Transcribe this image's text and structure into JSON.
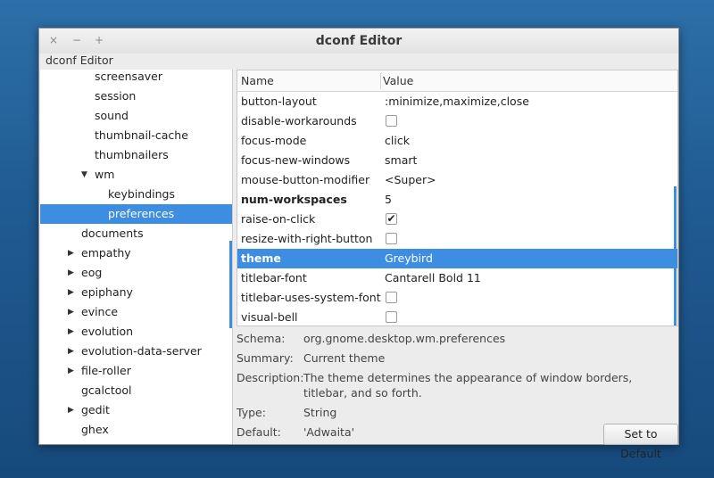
{
  "window": {
    "title": "dconf Editor",
    "menu_title": "dconf Editor",
    "buttons": {
      "close": "×",
      "minimize": "−",
      "maximize": "+"
    }
  },
  "sidebar": {
    "items": [
      {
        "label": "screensaver",
        "level": 2,
        "arrow": ""
      },
      {
        "label": "session",
        "level": 2,
        "arrow": ""
      },
      {
        "label": "sound",
        "level": 2,
        "arrow": ""
      },
      {
        "label": "thumbnail-cache",
        "level": 2,
        "arrow": ""
      },
      {
        "label": "thumbnailers",
        "level": 2,
        "arrow": ""
      },
      {
        "label": "wm",
        "level": 2,
        "arrow": "▼"
      },
      {
        "label": "keybindings",
        "level": 3,
        "arrow": ""
      },
      {
        "label": "preferences",
        "level": 3,
        "arrow": "",
        "selected": true
      },
      {
        "label": "documents",
        "level": 1,
        "arrow": ""
      },
      {
        "label": "empathy",
        "level": 1,
        "arrow": "▶"
      },
      {
        "label": "eog",
        "level": 1,
        "arrow": "▶"
      },
      {
        "label": "epiphany",
        "level": 1,
        "arrow": "▶"
      },
      {
        "label": "evince",
        "level": 1,
        "arrow": "▶"
      },
      {
        "label": "evolution",
        "level": 1,
        "arrow": "▶"
      },
      {
        "label": "evolution-data-server",
        "level": 1,
        "arrow": "▶"
      },
      {
        "label": "file-roller",
        "level": 1,
        "arrow": "▶"
      },
      {
        "label": "gcalctool",
        "level": 1,
        "arrow": ""
      },
      {
        "label": "gedit",
        "level": 1,
        "arrow": "▶"
      },
      {
        "label": "ghex",
        "level": 1,
        "arrow": ""
      }
    ]
  },
  "table": {
    "headers": {
      "name": "Name",
      "value": "Value"
    },
    "rows": [
      {
        "name": "button-layout",
        "value": ":minimize,maximize,close",
        "type": "text"
      },
      {
        "name": "disable-workarounds",
        "value": "",
        "type": "checkbox",
        "checked": false
      },
      {
        "name": "focus-mode",
        "value": "click",
        "type": "text"
      },
      {
        "name": "focus-new-windows",
        "value": "smart",
        "type": "text"
      },
      {
        "name": "mouse-button-modifier",
        "value": "<Super>",
        "type": "text"
      },
      {
        "name": "num-workspaces",
        "value": "5",
        "type": "text",
        "bold": true
      },
      {
        "name": "raise-on-click",
        "value": "",
        "type": "checkbox",
        "checked": true
      },
      {
        "name": "resize-with-right-button",
        "value": "",
        "type": "checkbox",
        "checked": false
      },
      {
        "name": "theme",
        "value": "Greybird",
        "type": "text",
        "bold": true,
        "selected": true
      },
      {
        "name": "titlebar-font",
        "value": "Cantarell Bold 11",
        "type": "text"
      },
      {
        "name": "titlebar-uses-system-font",
        "value": "",
        "type": "checkbox",
        "checked": false
      },
      {
        "name": "visual-bell",
        "value": "",
        "type": "checkbox",
        "checked": false
      }
    ]
  },
  "details": {
    "schema_label": "Schema:",
    "schema_value": "org.gnome.desktop.wm.preferences",
    "summary_label": "Summary:",
    "summary_value": "Current theme",
    "description_label": "Description:",
    "description_value": "The theme determines the appearance of window borders, titlebar, and so forth.",
    "type_label": "Type:",
    "type_value": "String",
    "default_label": "Default:",
    "default_value": "'Adwaita'"
  },
  "buttons": {
    "set_to_default": "Set to Default"
  },
  "colors": {
    "selection": "#3d8ee3",
    "desktop": "#1f5a91"
  }
}
